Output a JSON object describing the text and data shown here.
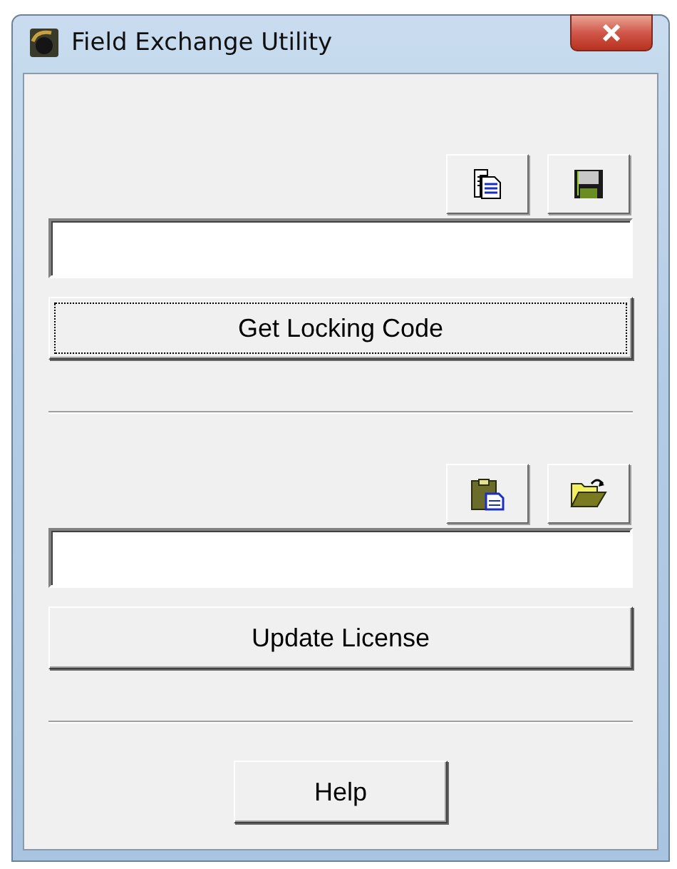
{
  "window": {
    "title": "Field Exchange Utility"
  },
  "sections": [
    {
      "tools": [
        {
          "kind": "copy"
        },
        {
          "kind": "save"
        }
      ],
      "button": {
        "label": "Get Locking Code",
        "focused": true
      }
    },
    {
      "tools": [
        {
          "kind": "paste"
        },
        {
          "kind": "open"
        }
      ],
      "button": {
        "label": "Update License",
        "focused": false
      }
    }
  ],
  "help_button": {
    "label": "Help",
    "focused": false
  }
}
